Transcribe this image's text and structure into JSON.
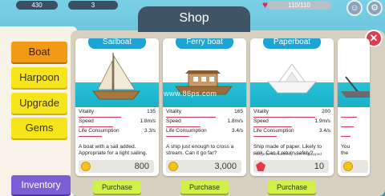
{
  "topbar": {
    "left_value": "430",
    "mid_value": "3",
    "hp_value": "110/110"
  },
  "shop": {
    "title": "Shop"
  },
  "menu": {
    "items": [
      {
        "label": "Boat"
      },
      {
        "label": "Harpoon"
      },
      {
        "label": "Upgrade"
      },
      {
        "label": "Gems"
      }
    ],
    "inventory_label": "Inventory"
  },
  "stat_labels": {
    "vitality": "Vitality",
    "speed": "Speed",
    "life": "Life Consumption"
  },
  "purchase_label": "Purchase",
  "cards": [
    {
      "name": "Sailboat",
      "vitality": "135",
      "speed": "1.8m/s",
      "life": "3.3/s",
      "vitality_level": 0.55,
      "speed_level": 0.45,
      "life_level": 0.3,
      "description": "A boat with a sail added. Appropriate for a light sailing.",
      "currency": "coin",
      "price": "800"
    },
    {
      "name": "Ferry boat",
      "vitality": "165",
      "speed": "1.8m/s",
      "life": "3.4/s",
      "vitality_level": 0.65,
      "speed_level": 0.45,
      "life_level": 0.3,
      "description": "A ship just enough to cross a stream. Can it go far?",
      "currency": "coin",
      "price": "3,000"
    },
    {
      "name": "Paperboat",
      "vitality": "200",
      "speed": "1.9m/s",
      "life": "3.4/s",
      "vitality_level": 0.8,
      "speed_level": 0.5,
      "life_level": 0.3,
      "description": "Ship made of paper. Likely to sink. Can it return safely?",
      "note": "Fish price increased by 30% if equipped",
      "currency": "gem",
      "price": "10"
    },
    {
      "partial_desc_1": "You",
      "partial_desc_2": "the"
    }
  ],
  "watermark": "www.86ps.com",
  "colors": {
    "accent_blue": "#1ca5d4",
    "menu_active": "#f29a14",
    "menu_item": "#f6e51a",
    "inventory": "#7b5fd6",
    "purchase": "#d2f04a",
    "close": "#e8384c"
  }
}
